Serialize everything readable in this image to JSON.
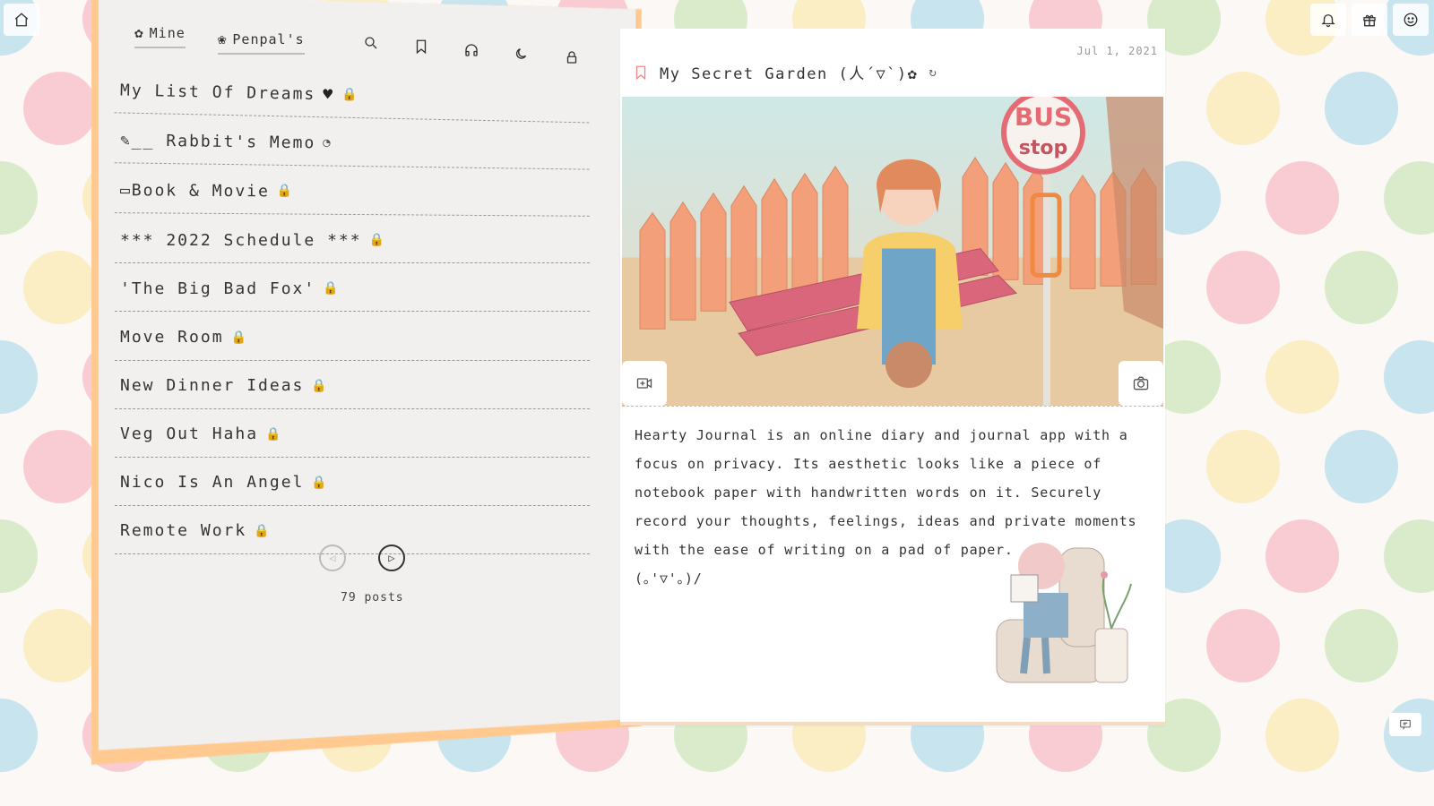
{
  "top_bar": {
    "home_icon": "home-icon",
    "right_icons": [
      "bell-icon",
      "gift-icon",
      "smiley-icon"
    ]
  },
  "left_panel": {
    "tabs": [
      {
        "label": "Mine",
        "icon": "flower-icon"
      },
      {
        "label": "Penpal's",
        "icon": "cloud-flower-icon"
      }
    ],
    "tools": [
      "search-icon",
      "bookmark-icon",
      "headphones-icon",
      "moon-icon",
      "lock-icon"
    ],
    "posts": [
      {
        "title": "My List Of Dreams",
        "badges": [
          "♥",
          "🔒"
        ]
      },
      {
        "title": "✎__ Rabbit's Memo",
        "badges": [
          "◔"
        ]
      },
      {
        "title": "▭Book & Movie",
        "badges": [
          "🔒"
        ]
      },
      {
        "title": "*** 2022 Schedule ***",
        "badges": [
          "🔒"
        ]
      },
      {
        "title": "'The Big Bad Fox'",
        "badges": [
          "🔒"
        ]
      },
      {
        "title": "Move Room",
        "badges": [
          "🔒"
        ]
      },
      {
        "title": "New Dinner Ideas",
        "badges": [
          "🔒"
        ]
      },
      {
        "title": "Veg Out Haha",
        "badges": [
          "🔒"
        ]
      },
      {
        "title": "Nico Is An Angel",
        "badges": [
          "🔒"
        ]
      },
      {
        "title": "Remote Work",
        "badges": [
          "🔒"
        ]
      }
    ],
    "pager": {
      "prev": "◁",
      "next": "▷",
      "posts_count": "79 posts"
    }
  },
  "right_panel": {
    "date": "Jul 1, 2021",
    "title": "My Secret Garden (人´▽`)✿",
    "sync_icon": "sync-icon",
    "cover_buttons": [
      "add-video-icon",
      "camera-icon"
    ],
    "cover_sign": {
      "top": "BUS",
      "bottom": "stop"
    },
    "body": "Hearty Journal is an online diary and journal app with a focus on privacy. Its aesthetic looks like a piece of notebook paper with handwritten words on it. Securely record your thoughts, feelings, ideas and private moments with the ease of writing on a pad of paper.",
    "emoticon": "(｡'▽'｡)/"
  },
  "colors": {
    "accent_orange": "#ffc98f",
    "paper": "#f1f0ee",
    "bookmark_pink": "#ee8888"
  }
}
